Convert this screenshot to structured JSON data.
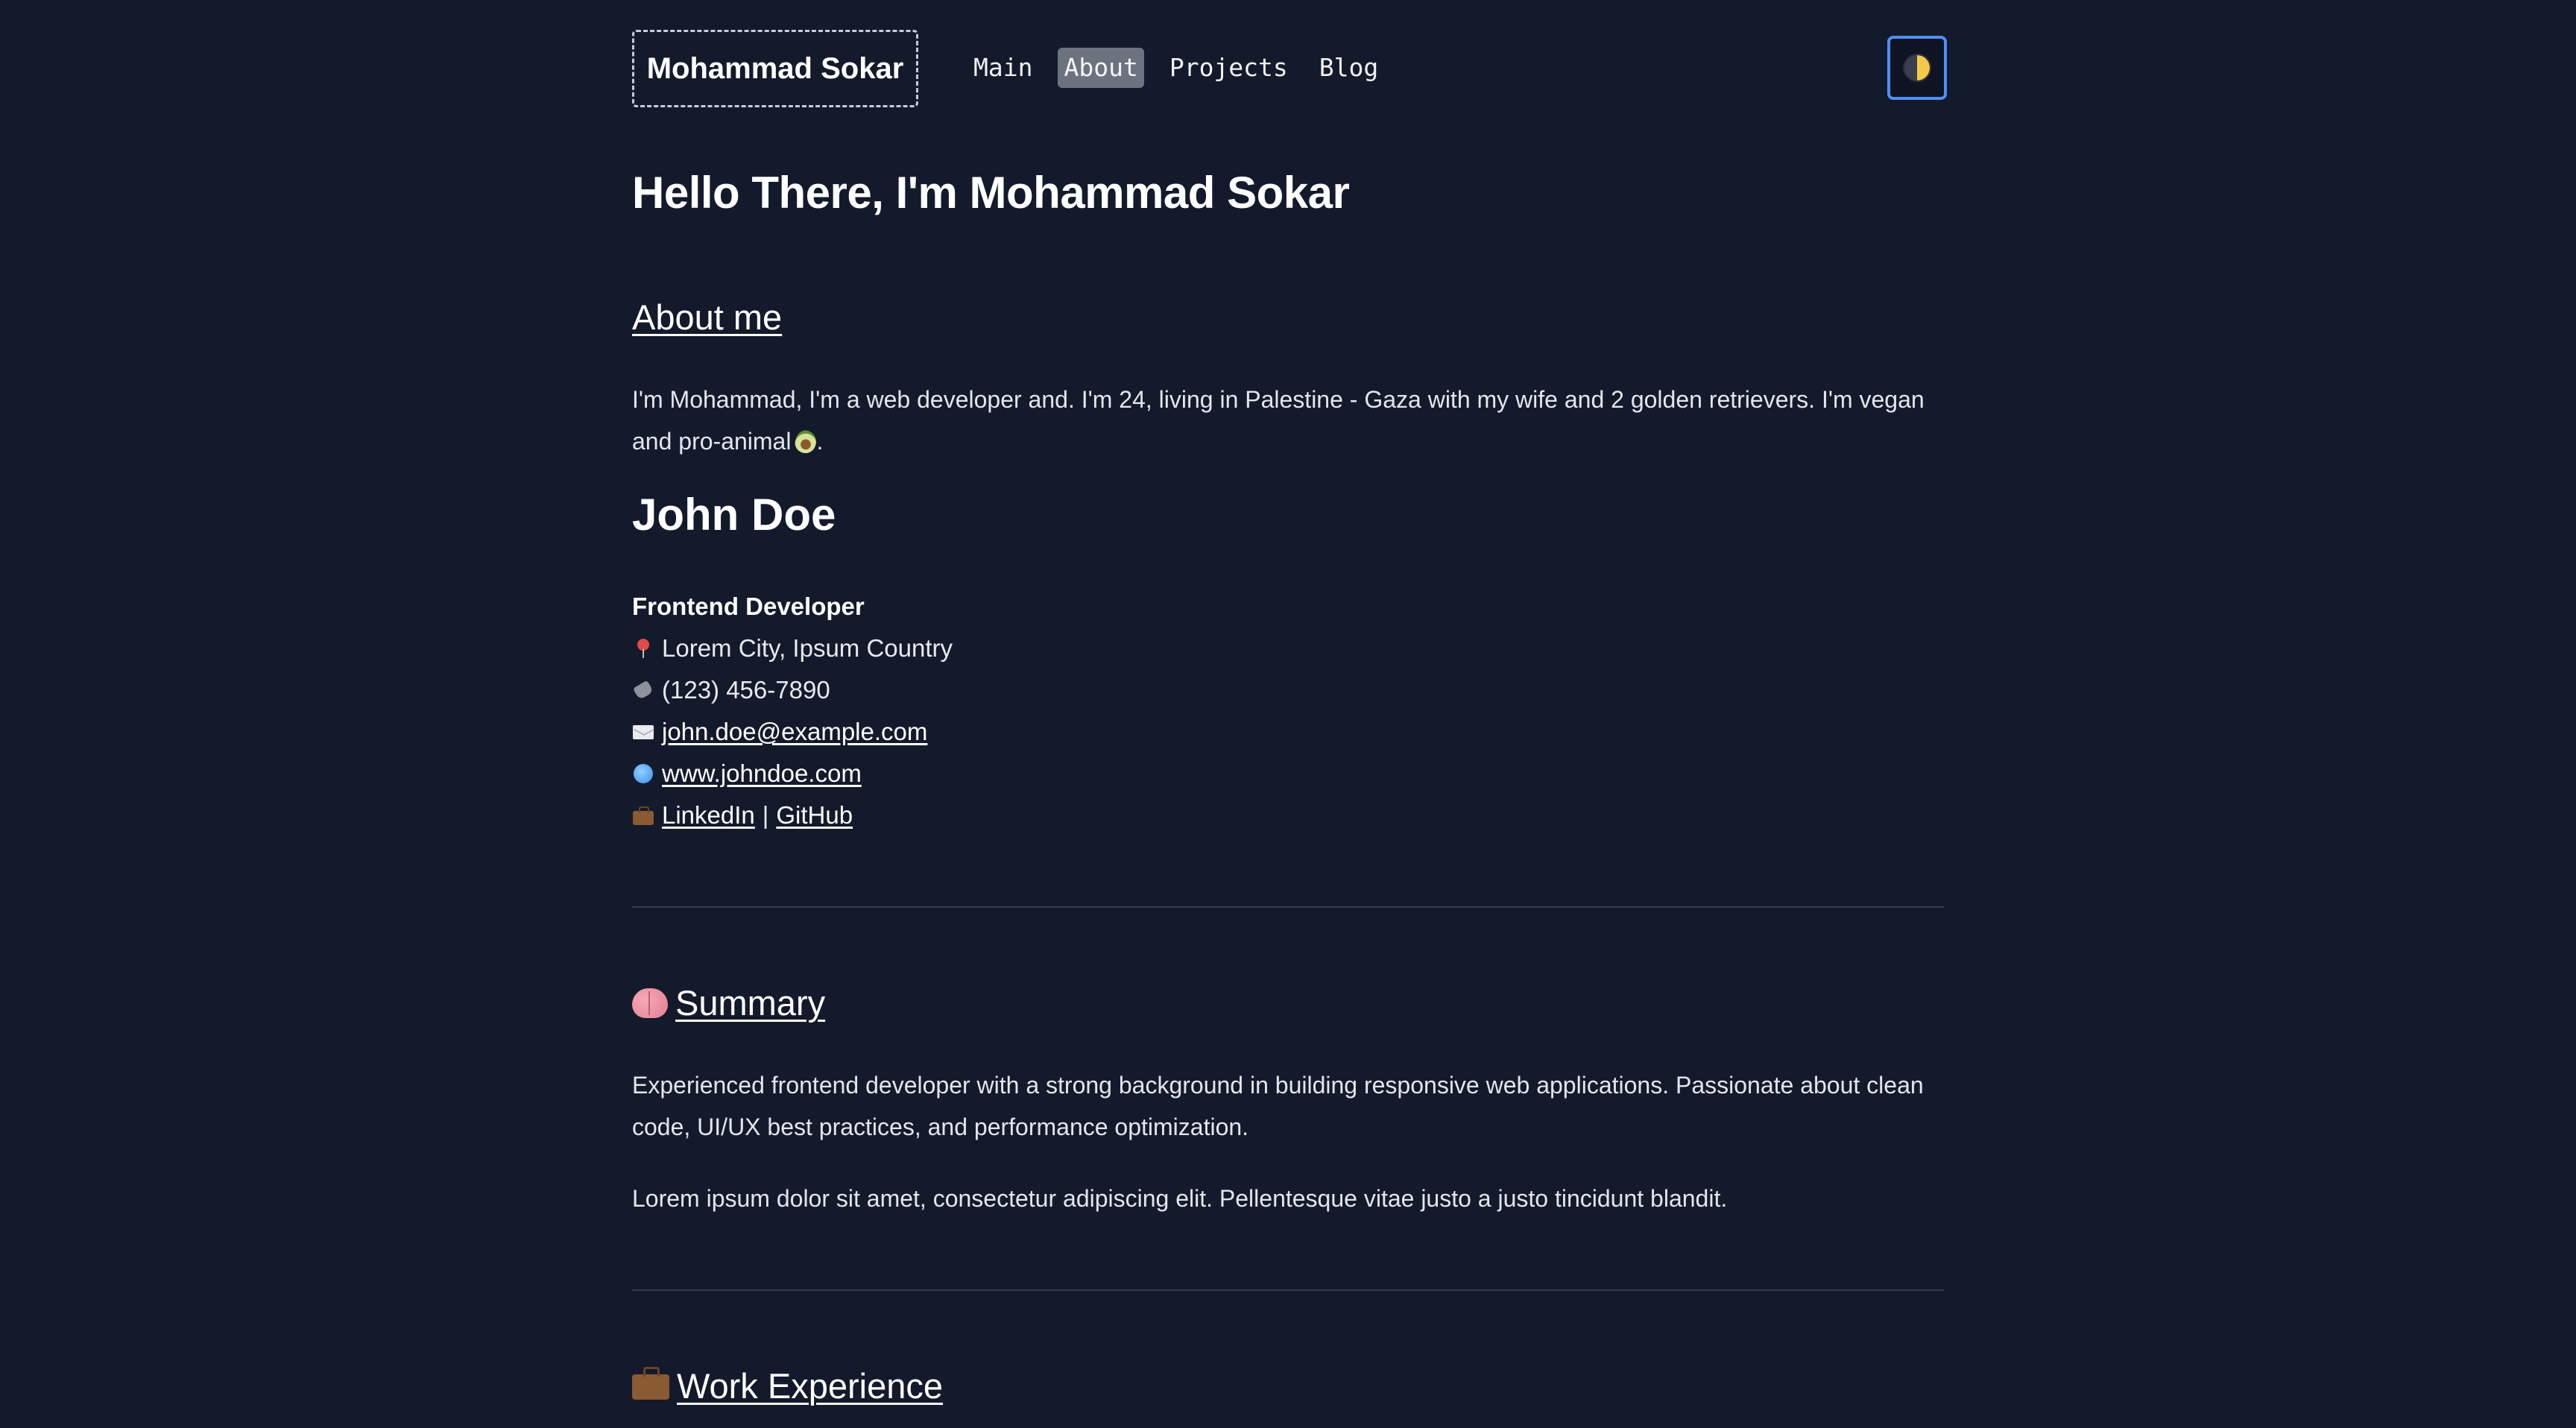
{
  "header": {
    "site_title": "Mohammad Sokar",
    "nav": [
      {
        "label": "Main"
      },
      {
        "label": "About"
      },
      {
        "label": "Projects"
      },
      {
        "label": "Blog"
      }
    ],
    "active_nav": "About",
    "theme_toggle_icon": "half-moon-icon"
  },
  "hero": {
    "title": "Hello There, I'm Mohammad Sokar"
  },
  "about": {
    "heading": "About me",
    "text": "I'm Mohammad, I'm a web developer and. I'm 24, living in Palestine - Gaza with my wife and 2 golden retrievers. I'm vegan and pro-animal",
    "text_end": "."
  },
  "resume": {
    "name": "John Doe",
    "role": "Frontend Developer",
    "location": "Lorem City, Ipsum Country",
    "phone": "(123) 456-7890",
    "email": "john.doe@example.com",
    "website": "www.johndoe.com",
    "linkedin": "LinkedIn",
    "separator": "|",
    "github": "GitHub"
  },
  "summary": {
    "heading": "Summary",
    "paragraph1": "Experienced frontend developer with a strong background in building responsive web applications. Passionate about clean code, UI/UX best practices, and performance optimization.",
    "paragraph2": "Lorem ipsum dolor sit amet, consectetur adipiscing elit. Pellentesque vitae justo a justo tincidunt blandit."
  },
  "work": {
    "heading": "Work Experience"
  },
  "colors": {
    "background": "#131a2b",
    "text": "#e8eaf0",
    "active_nav_bg": "#6b7280",
    "toggle_border": "#4f8ff7"
  }
}
